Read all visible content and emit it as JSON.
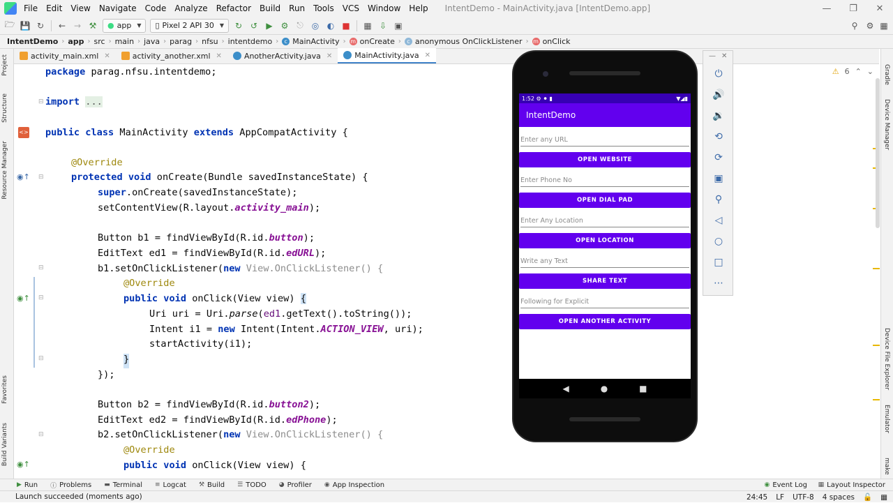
{
  "menu": {
    "items": [
      "File",
      "Edit",
      "View",
      "Navigate",
      "Code",
      "Analyze",
      "Refactor",
      "Build",
      "Run",
      "Tools",
      "VCS",
      "Window",
      "Help"
    ],
    "window_title": "IntentDemo - MainActivity.java [IntentDemo.app]"
  },
  "toolbar": {
    "run_config": "app",
    "device": "Pixel 2 API 30"
  },
  "breadcrumb": [
    "IntentDemo",
    "app",
    "src",
    "main",
    "java",
    "parag",
    "nfsu",
    "intentdemo",
    "MainActivity",
    "onCreate",
    "anonymous OnClickListener",
    "onClick"
  ],
  "tabs": [
    "activity_main.xml",
    "activity_another.xml",
    "AnotherActivity.java",
    "MainActivity.java"
  ],
  "left_strip": [
    "Project",
    "Structure",
    "Resource Manager",
    "Favorites",
    "Build Variants"
  ],
  "right_strip": [
    "Gradle",
    "Device Manager",
    "Device File Explorer",
    "Emulator",
    "make"
  ],
  "inspection": {
    "warnings": "6"
  },
  "code": {
    "l1a": "package",
    "l1b": " parag.nfsu.intentdemo;",
    "l2a": "import",
    "l2b": "...",
    "l3a": "public class",
    "l3b": " MainActivity ",
    "l3c": "extends",
    "l3d": " AppCompatActivity {",
    "l4": "@Override",
    "l5a": "protected void",
    "l5b": " onCreate(Bundle savedInstanceState) {",
    "l6a": "super",
    "l6b": ".onCreate(savedInstanceState);",
    "l7a": "setContentView(R.layout.",
    "l7b": "activity_main",
    "l7c": ");",
    "l8a": "Button b1 = findViewById(R.id.",
    "l8b": "button",
    "l8c": ");",
    "l9a": "EditText ed1 = findViewById(R.id.",
    "l9b": "edURL",
    "l9c": ");",
    "l10a": "b1.setOnClickListener(",
    "l10b": "new",
    "l10c": " View.OnClickListener() {",
    "l11": "@Override",
    "l12a": "public void",
    "l12b": " onClick(View view) ",
    "l12c": "{",
    "l13a": "Uri uri = Uri.",
    "l13b": "parse",
    "l13c": "(",
    "l13d": "ed1",
    "l13e": ".getText().toString());",
    "l14a": "Intent i1 = ",
    "l14b": "new",
    "l14c": " Intent(Intent.",
    "l14d": "ACTION_VIEW",
    "l14e": ", uri);",
    "l15": "startActivity(i1);",
    "l16": "}",
    "l17": "});",
    "l18a": "Button b2 = findViewById(R.id.",
    "l18b": "button2",
    "l18c": ");",
    "l19a": "EditText ed2 = findViewById(R.id.",
    "l19b": "edPhone",
    "l19c": ");",
    "l20a": "b2.setOnClickListener(",
    "l20b": "new",
    "l20c": " View.OnClickListener() {",
    "l21": "@Override",
    "l22a": "public void",
    "l22b": " onClick(View view) {"
  },
  "emulator": {
    "time": "1:52",
    "app_title": "IntentDemo",
    "fields": [
      {
        "placeholder": "Enter any URL",
        "button": "OPEN WEBSITE"
      },
      {
        "placeholder": "Enter Phone No",
        "button": "OPEN DIAL PAD"
      },
      {
        "placeholder": "Enter Any Location",
        "button": "OPEN LOCATION"
      },
      {
        "placeholder": "Write any Text",
        "button": "SHARE TEXT"
      },
      {
        "placeholder": "Following for Explicit",
        "button": "OPEN ANOTHER ACTIVITY"
      }
    ]
  },
  "bottom_tools": [
    "Run",
    "Problems",
    "Terminal",
    "Logcat",
    "Build",
    "TODO",
    "Profiler",
    "App Inspection"
  ],
  "bottom_right_tools": [
    "Event Log",
    "Layout Inspector"
  ],
  "status": {
    "message": "Launch succeeded (moments ago)",
    "position": "24:45",
    "line_sep": "LF",
    "encoding": "UTF-8",
    "indent": "4 spaces"
  },
  "colors": {
    "primary": "#6200ee",
    "primary_dark": "#3700b3",
    "accent": "#4083c9"
  }
}
